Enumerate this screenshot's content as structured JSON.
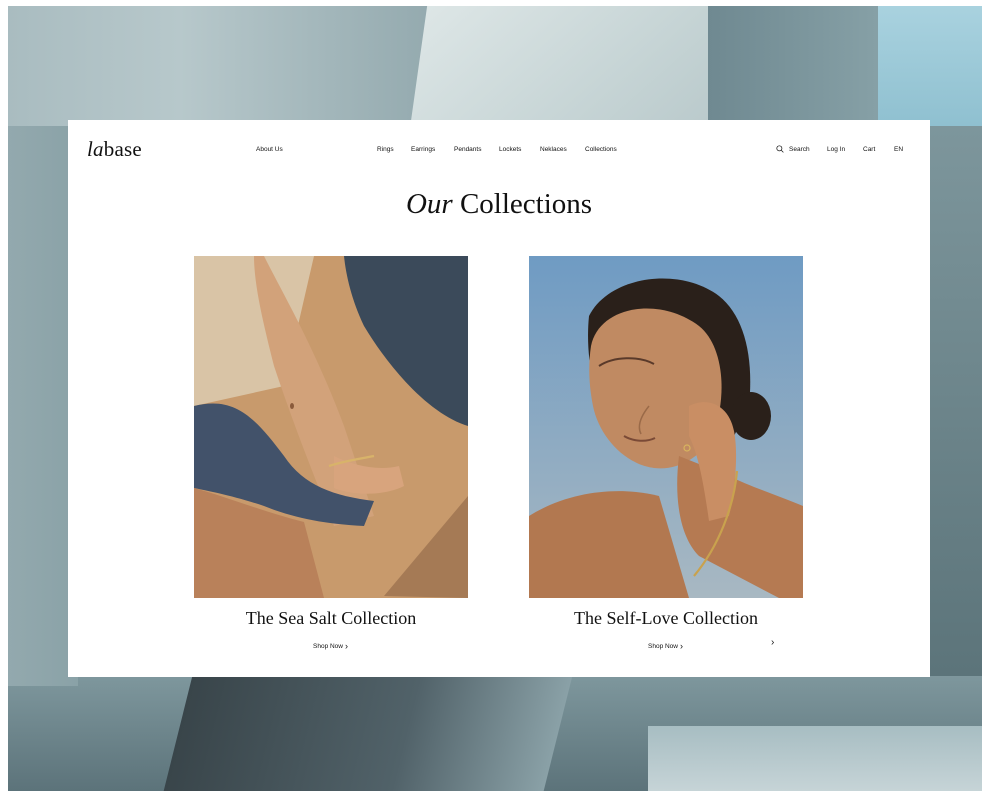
{
  "brand": {
    "logo_italic": "la",
    "logo_rest": "base"
  },
  "nav": {
    "about": "About Us",
    "rings": "Rings",
    "earrings": "Earrings",
    "pendants": "Pendants",
    "lockets": "Lockets",
    "neklaces": "Neklaces",
    "collections": "Collections",
    "search": "Search",
    "login": "Log In",
    "cart": "Cart",
    "lang": "EN"
  },
  "heading": {
    "italic": "Our",
    "rest": "Collections"
  },
  "collections": [
    {
      "title": "The Sea Salt Collection",
      "cta": "Shop Now"
    },
    {
      "title": "The Self-Love Collection",
      "cta": "Shop Now"
    }
  ],
  "icons": {
    "search": "search-icon",
    "chevron": "chevron-right-icon"
  }
}
